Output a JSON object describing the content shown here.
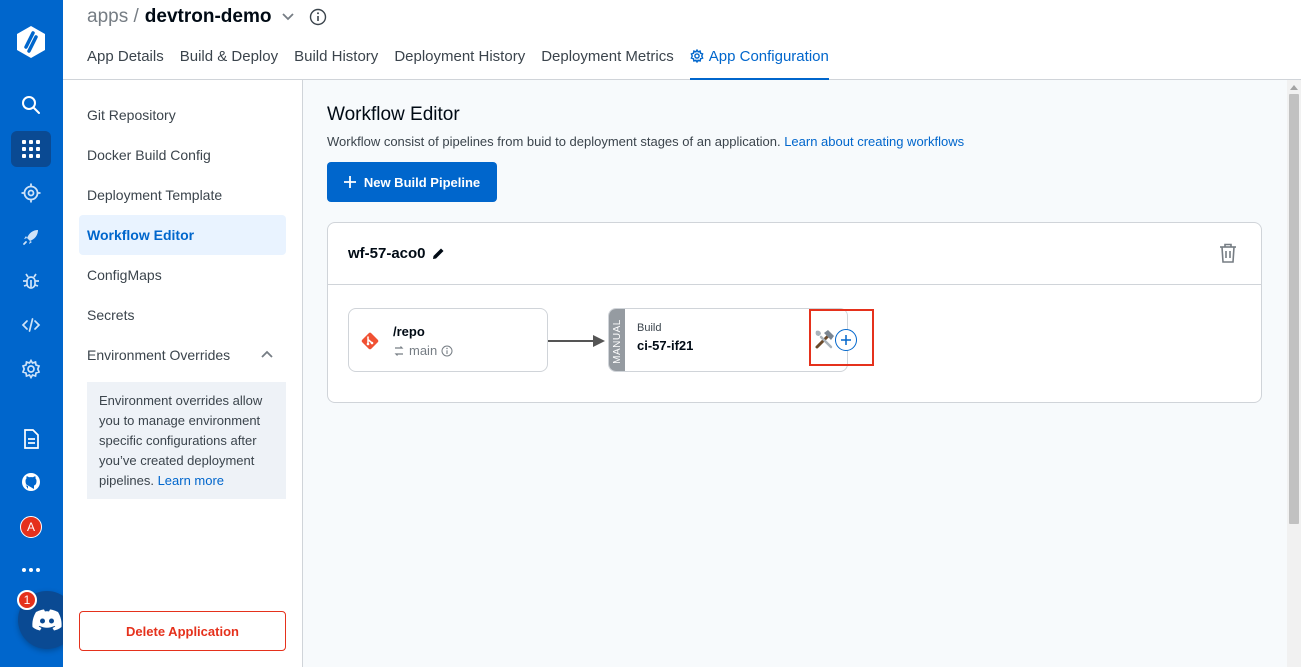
{
  "header": {
    "crumb": "apps /",
    "app_name": "devtron-demo",
    "tabs": [
      {
        "label": "App Details",
        "active": false
      },
      {
        "label": "Build & Deploy",
        "active": false
      },
      {
        "label": "Build History",
        "active": false
      },
      {
        "label": "Deployment History",
        "active": false
      },
      {
        "label": "Deployment Metrics",
        "active": false
      },
      {
        "label": "App Configuration",
        "active": true
      }
    ]
  },
  "rail": {
    "icons": [
      "devtron-logo-icon",
      "search-icon",
      "apps-grid-icon",
      "chart-store-icon",
      "deploy-rocket-icon",
      "security-bug-icon",
      "code-icon",
      "settings-gear-icon",
      "docs-icon",
      "github-icon",
      "more-icon"
    ],
    "avatar_initial": "A",
    "discord_badge": "1"
  },
  "sidebar": {
    "items": [
      {
        "label": "Git Repository"
      },
      {
        "label": "Docker Build Config"
      },
      {
        "label": "Deployment Template"
      },
      {
        "label": "Workflow Editor"
      },
      {
        "label": "ConfigMaps"
      },
      {
        "label": "Secrets"
      },
      {
        "label": "Environment Overrides"
      }
    ],
    "active_item": "Workflow Editor",
    "env_note": "Environment overrides allow you to manage environment specific configurations after you’ve created deployment pipelines.",
    "env_note_link": "Learn more",
    "delete_label": "Delete Application"
  },
  "main": {
    "title": "Workflow Editor",
    "subtitle": "Workflow consist of pipelines from buid to deployment stages of an application.",
    "subtitle_link": "Learn about creating workflows",
    "new_button": "New Build Pipeline",
    "workflow": {
      "name": "wf-57-aco0",
      "git_node": {
        "repo": "/repo",
        "branch": "main"
      },
      "build_node": {
        "trigger": "MANUAL",
        "type": "Build",
        "name": "ci-57-if21"
      }
    }
  },
  "colors": {
    "brand": "#0066cc",
    "rail_active": "#0a4a93",
    "danger": "#e5311c",
    "active_bg": "#e9f3ff"
  }
}
